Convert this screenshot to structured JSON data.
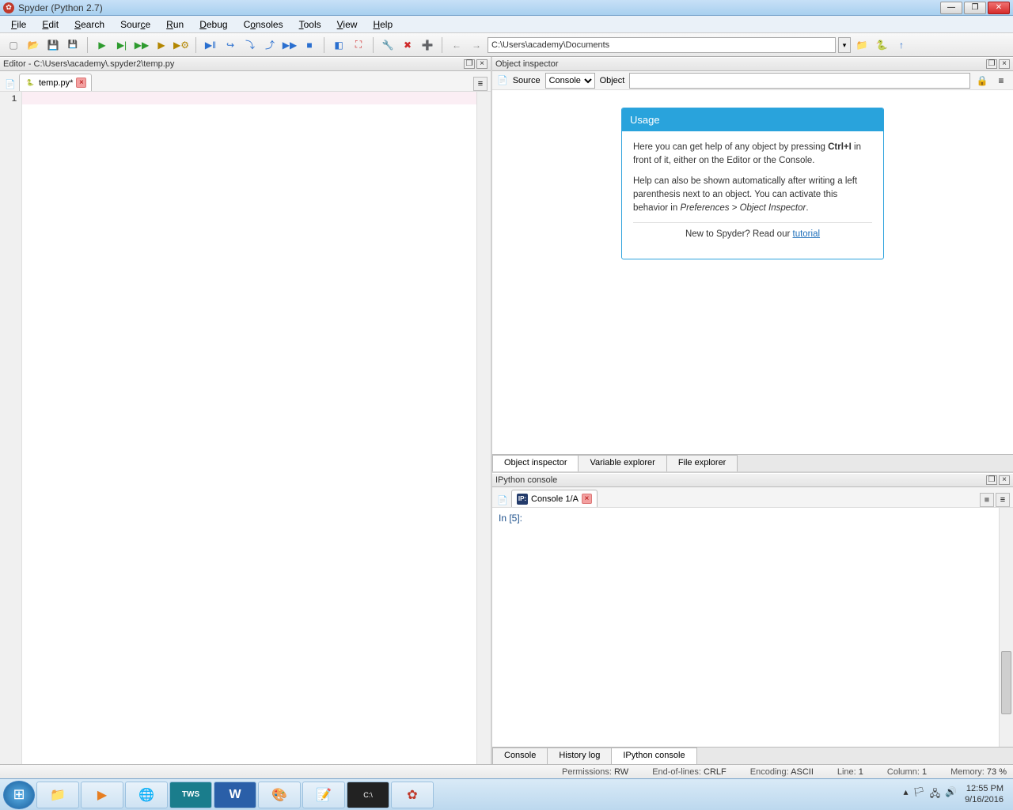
{
  "titlebar": {
    "title": "Spyder (Python 2.7)"
  },
  "menu": {
    "file": "File",
    "edit": "Edit",
    "search": "Search",
    "source": "Source",
    "run": "Run",
    "debug": "Debug",
    "consoles": "Consoles",
    "tools": "Tools",
    "view": "View",
    "help": "Help"
  },
  "toolbar": {
    "path": "C:\\Users\\academy\\Documents"
  },
  "editor": {
    "header": "Editor - C:\\Users\\academy\\.spyder2\\temp.py",
    "tab_name": "temp.py*",
    "line_number": "1"
  },
  "inspector": {
    "header": "Object inspector",
    "source_label": "Source",
    "source_value": "Console",
    "object_label": "Object",
    "object_value": "",
    "usage_title": "Usage",
    "usage_p1a": "Here you can get help of any object by pressing ",
    "usage_p1b": "Ctrl+I",
    "usage_p1c": " in front of it, either on the Editor or the Console.",
    "usage_p2a": "Help can also be shown automatically after writing a left parenthesis next to an object. You can activate this behavior in ",
    "usage_p2b": "Preferences > Object Inspector",
    "usage_p2c": ".",
    "usage_footer_a": "New to Spyder? Read our ",
    "usage_footer_link": "tutorial",
    "tabs": {
      "obj": "Object inspector",
      "var": "Variable explorer",
      "file": "File explorer"
    }
  },
  "console": {
    "header": "IPython console",
    "tab_name": "Console 1/A",
    "prompt": "In [5]:",
    "tabs": {
      "console": "Console",
      "history": "History log",
      "ipython": "IPython console"
    }
  },
  "status": {
    "permissions_lbl": "Permissions:",
    "permissions": "RW",
    "eol_lbl": "End-of-lines:",
    "eol": "CRLF",
    "encoding_lbl": "Encoding:",
    "encoding": "ASCII",
    "line_lbl": "Line:",
    "line": "1",
    "col_lbl": "Column:",
    "col": "1",
    "mem_lbl": "Memory:",
    "mem": "73 %"
  },
  "taskbar": {
    "time": "12:55 PM",
    "date": "9/16/2016"
  }
}
